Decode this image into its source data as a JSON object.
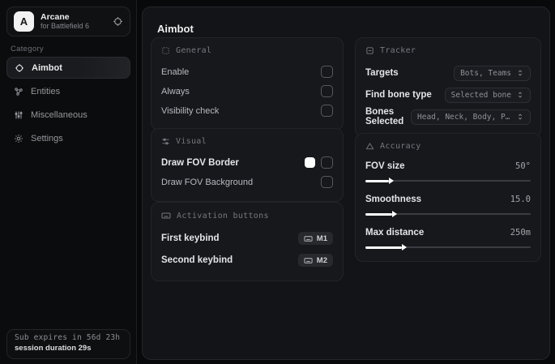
{
  "app": {
    "logo_letter": "A",
    "name": "Arcane",
    "subtitle": "for Battlefield 6"
  },
  "sidebar": {
    "category_label": "Category",
    "items": [
      {
        "label": "Aimbot",
        "icon": "crosshair-icon",
        "active": true
      },
      {
        "label": "Entities",
        "icon": "entities-icon",
        "active": false
      },
      {
        "label": "Miscellaneous",
        "icon": "adjustments-icon",
        "active": false
      },
      {
        "label": "Settings",
        "icon": "gear-icon",
        "active": false
      }
    ],
    "subscription": {
      "expires": "Sub expires in 56d 23h",
      "session": "session duration 29s"
    }
  },
  "page": {
    "title": "Aimbot"
  },
  "cards": {
    "general": {
      "title": "General",
      "rows": [
        {
          "label": "Enable",
          "checked": false
        },
        {
          "label": "Always",
          "checked": false
        },
        {
          "label": "Visibility check",
          "checked": false
        }
      ]
    },
    "visual": {
      "title": "Visual",
      "rows": [
        {
          "label": "Draw FOV Border",
          "swatch": "#ffffff",
          "checked": false
        },
        {
          "label": "Draw FOV Background",
          "checked": false
        }
      ]
    },
    "activation": {
      "title": "Activation buttons",
      "rows": [
        {
          "label": "First keybind",
          "key": "M1"
        },
        {
          "label": "Second keybind",
          "key": "M2"
        }
      ]
    },
    "tracker": {
      "title": "Tracker",
      "rows": [
        {
          "label": "Targets",
          "value": "Bots, Teams"
        },
        {
          "label": "Find bone type",
          "value": "Selected bone"
        },
        {
          "label": "Bones Selected",
          "value": "Head, Neck, Body, Pe..."
        }
      ]
    },
    "accuracy": {
      "title": "Accuracy",
      "rows": [
        {
          "label": "FOV size",
          "value": "50°",
          "percent": 14
        },
        {
          "label": "Smoothness",
          "value": "15.0",
          "percent": 16
        },
        {
          "label": "Max distance",
          "value": "250m",
          "percent": 22
        }
      ]
    }
  },
  "icons": {
    "crosshair-icon": "target circle with ticks",
    "entities-icon": "nodes/users glyph",
    "adjustments-icon": "vertical sliders",
    "gear-icon": "cog",
    "general-icon": "dashed settings square",
    "visual-icon": "horizontal sliders",
    "keyboard-icon": "keyboard",
    "tracker-icon": "minus in square",
    "accuracy-icon": "triangle",
    "chevrons-up-down-icon": "expand chevrons"
  },
  "colors": {
    "background": "#08090a",
    "panel": "#131417",
    "card": "#17181b",
    "border": "#25262b",
    "text_primary": "#ececee",
    "text_muted": "#8c8f95",
    "accent": "#ffffff"
  }
}
